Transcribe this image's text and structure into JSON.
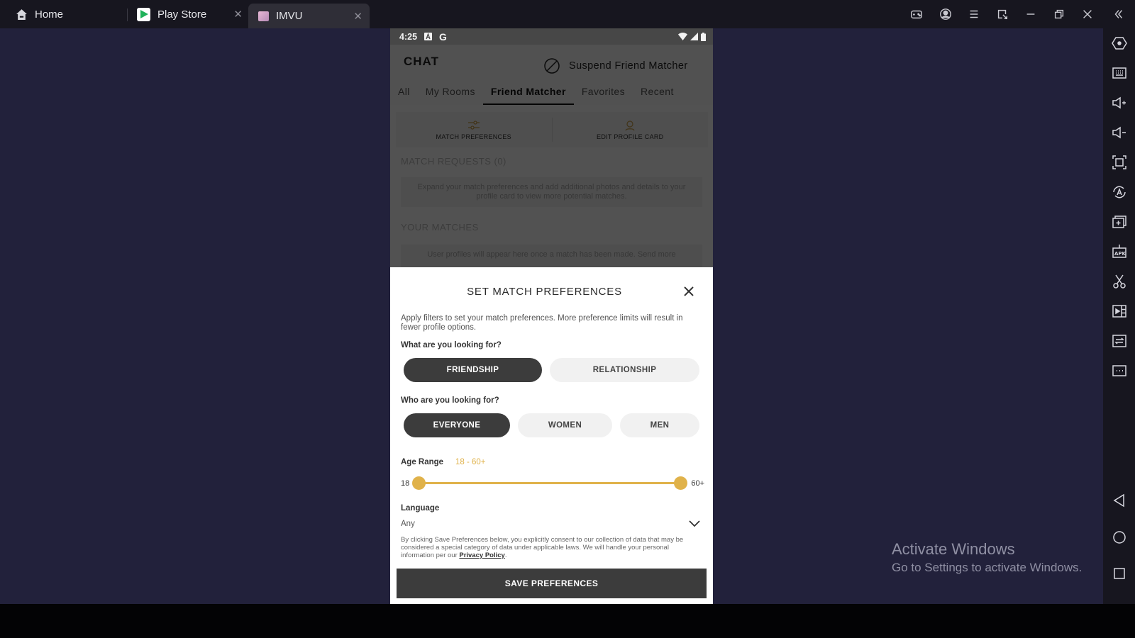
{
  "window": {
    "tabs": [
      {
        "label": "Home",
        "icon": "home-icon"
      },
      {
        "label": "Play Store",
        "icon": "play-store-icon",
        "closable": true
      },
      {
        "label": "IMVU",
        "icon": "imvu-icon",
        "closable": true,
        "active": true
      }
    ],
    "close_glyph": "✕",
    "controls": [
      "gamepad-icon",
      "account-icon",
      "menu-icon",
      "resize-icon",
      "minimize-icon",
      "restore-icon",
      "close-icon",
      "collapse-sidebar-icon"
    ]
  },
  "right_sidebar": {
    "tools": [
      "settings-hex-icon",
      "keyboard-icon",
      "volume-up-icon",
      "volume-down-icon",
      "screenshot-frame-icon",
      "auto-rotate-icon",
      "multi-instance-icon",
      "apk-install-icon",
      "scissors-icon",
      "media-player-icon",
      "sync-icon",
      "more-icon"
    ],
    "nav": [
      "back-icon",
      "home-circle-icon",
      "recents-icon"
    ]
  },
  "phone": {
    "status": {
      "time": "4:25",
      "icons": [
        "notification-a-icon",
        "google-icon",
        "wifi-icon",
        "signal-icon",
        "battery-icon"
      ]
    },
    "header": {
      "title": "CHAT",
      "suspend_label": "Suspend Friend Matcher"
    },
    "tabs": [
      {
        "label": "All"
      },
      {
        "label": "My Rooms"
      },
      {
        "label": "Friend Matcher",
        "active": true
      },
      {
        "label": "Favorites"
      },
      {
        "label": "Recent"
      }
    ],
    "sub_actions": [
      {
        "label": "MATCH PREFERENCES",
        "icon": "sliders-icon"
      },
      {
        "label": "EDIT PROFILE CARD",
        "icon": "profile-icon"
      }
    ],
    "match_requests": {
      "title": "MATCH REQUESTS (0)",
      "text": "Expand your match preferences and add additional photos and details to your profile card to view more potential matches."
    },
    "your_matches": {
      "title": "YOUR MATCHES",
      "text": "User profiles will appear here once a match has been made. Send more"
    }
  },
  "dialog": {
    "title": "SET MATCH PREFERENCES",
    "intro": "Apply filters to set your match preferences. More preference limits will result in fewer profile options.",
    "looking_for": {
      "question": "What are you looking for?",
      "options": [
        {
          "label": "FRIENDSHIP",
          "selected": true
        },
        {
          "label": "RELATIONSHIP",
          "selected": false
        }
      ]
    },
    "who": {
      "question": "Who are you looking for?",
      "options": [
        {
          "label": "EVERYONE",
          "selected": true
        },
        {
          "label": "WOMEN",
          "selected": false
        },
        {
          "label": "MEN",
          "selected": false
        }
      ]
    },
    "age": {
      "label": "Age Range",
      "value_text": "18 - 60+",
      "min_label": "18",
      "max_label": "60+",
      "low_fraction": 0,
      "high_fraction": 1
    },
    "language": {
      "label": "Language",
      "value": "Any"
    },
    "consent": {
      "text": "By clicking Save Preferences below, you explicitly consent to our collection of data that may be considered a special category of data under applicable laws. We will handle your personal information per our ",
      "link": "Privacy Policy",
      "end": "."
    },
    "save_label": "SAVE PREFERENCES",
    "accent_color": "#e0b24a"
  },
  "watermark": {
    "line1": "Activate Windows",
    "line2": "Go to Settings to activate Windows."
  }
}
